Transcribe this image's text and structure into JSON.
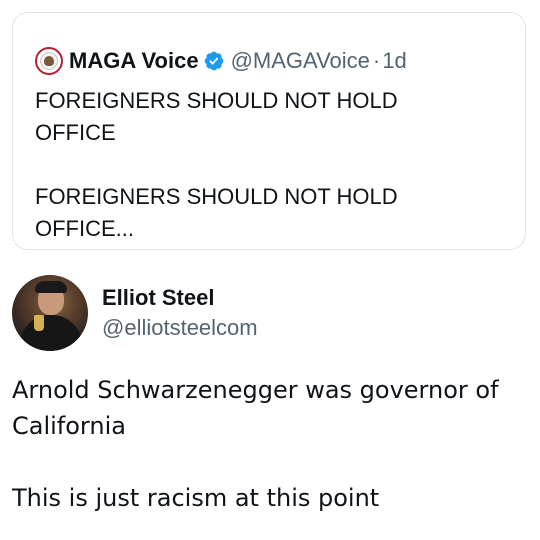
{
  "quoted_post": {
    "author_name": "MAGA Voice",
    "verified_icon": "verified-badge-icon",
    "handle": "@MAGAVoice",
    "separator": "·",
    "time": "1d",
    "text": "FOREIGNERS SHOULD NOT HOLD\nOFFICE\n\nFOREIGNERS SHOULD NOT HOLD\nOFFICE..."
  },
  "post": {
    "author_name": "Elliot Steel",
    "handle": "@elliotsteelcom",
    "text": "Arnold Schwarzenegger was governor of\nCalifornia\n\nThis is just racism at this point"
  },
  "colors": {
    "text_primary": "#0f1419",
    "text_secondary": "#536471",
    "verified_blue": "#1d9bf0",
    "card_border": "#e3e6e9"
  }
}
